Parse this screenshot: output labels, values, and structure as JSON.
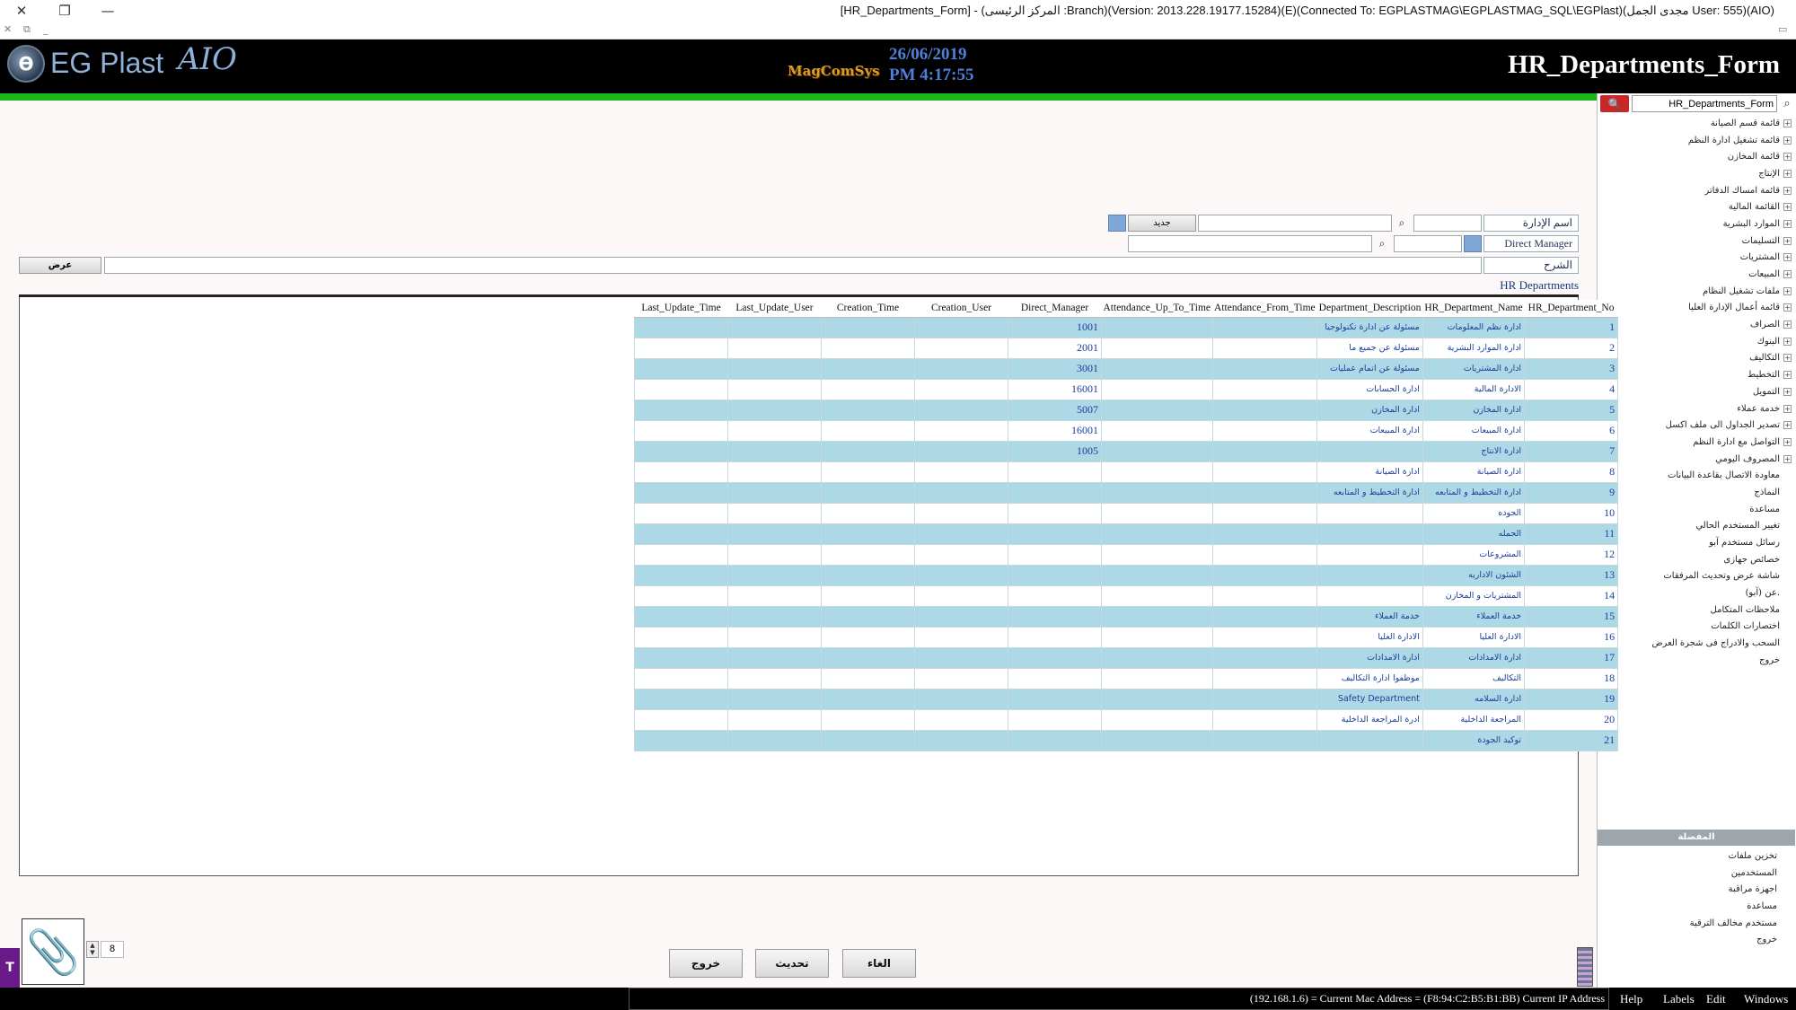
{
  "window": {
    "title": "[HR_Departments_Form] - (المركز الرئيسى :Branch)(Version: 2013.228.19177.15284)(E)(Connected To: EGPLASTMAG\\EGPLASTMAG_SQL\\EGPlast)(مجدى الجمل User: 555)(AIO)",
    "close": "✕",
    "restore": "❐",
    "minimize": "—"
  },
  "mdi": {
    "close": "✕",
    "restore": "⧉",
    "minimize": "_",
    "right_icon": "▭"
  },
  "header": {
    "logo_text": "EG Plast",
    "logo_suffix": "AIO",
    "brand": "MagComSys",
    "date": "26/06/2019",
    "time": "PM 4:17:55",
    "form_title": "HR_Departments_Form"
  },
  "nav": {
    "search_value": "HR_Departments_Form",
    "tree": [
      {
        "label": "قائمة قسم الصيانة",
        "exp": true
      },
      {
        "label": "قائمة تشغيل ادارة النظم",
        "exp": true
      },
      {
        "label": "قائمة المخازن",
        "exp": true
      },
      {
        "label": "الإنتاج",
        "exp": true
      },
      {
        "label": "قائمة امساك الدفاتر",
        "exp": true
      },
      {
        "label": "القائمة المالية",
        "exp": true
      },
      {
        "label": "الموارد البشرية",
        "exp": true
      },
      {
        "label": "التسليمات",
        "exp": true
      },
      {
        "label": "المشتريات",
        "exp": true
      },
      {
        "label": "المبيعات",
        "exp": true
      },
      {
        "label": "ملفات تشغيل النظام",
        "exp": true
      },
      {
        "label": "قائمة أعمال الإدارة العليا",
        "exp": true
      },
      {
        "label": "الصراف",
        "exp": true
      },
      {
        "label": "البنوك",
        "exp": true
      },
      {
        "label": "التكاليف",
        "exp": true
      },
      {
        "label": "التخطيط",
        "exp": true
      },
      {
        "label": "التمويل",
        "exp": true
      },
      {
        "label": "خدمة عملاء",
        "exp": true
      },
      {
        "label": "تصدير الجداول الى ملف اكسل",
        "exp": true
      },
      {
        "label": "التواصل مع ادارة النظم",
        "exp": true
      },
      {
        "label": "المصروف اليومي",
        "exp": true
      },
      {
        "label": "معاودة الاتصال بقاعدة البيانات",
        "exp": false
      },
      {
        "label": "النماذج",
        "exp": false
      },
      {
        "label": "مساعدة",
        "exp": false
      },
      {
        "label": "تغيير المستخدم الحالي",
        "exp": false
      },
      {
        "label": "رسائل مستخدم آبو",
        "exp": false
      },
      {
        "label": "خصائص جهازى",
        "exp": false
      },
      {
        "label": "شاشة عرض وتحديث المرفقات",
        "exp": false
      },
      {
        "label": "عن (آبو).",
        "exp": false
      },
      {
        "label": "ملاحظات المتكامل",
        "exp": false
      },
      {
        "label": "اختصارات الكلمات",
        "exp": false
      },
      {
        "label": "السحب والادراج فى شجرة العرض",
        "exp": false
      },
      {
        "label": "خروج",
        "exp": false
      }
    ],
    "favorites_header": "المفضلة",
    "favorites": [
      "تخزين ملفات",
      "المستخدمين",
      "اجهزة مراقبة",
      "مساعدة",
      "مستخدم مخالف الترقية",
      "خروج"
    ]
  },
  "form": {
    "dept_name_label": "اسم الإدارة",
    "new_button": "جديد",
    "direct_manager_label": "Direct Manager",
    "description_label": "الشرح",
    "view_button": "عرض",
    "section_title": "HR Departments"
  },
  "grid": {
    "columns": [
      "Last_Update_Time",
      "Last_Update_User",
      "Creation_Time",
      "Creation_User",
      "Direct_Manager",
      "Attendance_Up_To_Time",
      "Attendance_From_Time",
      "Department_Description",
      "HR_Department_Name",
      "HR_Department_No"
    ],
    "rows": [
      {
        "no": "1",
        "name": "ادارة نظم المعلومات",
        "desc": "مسئولة عن ادارة تكنولوجيا",
        "mgr": "1001"
      },
      {
        "no": "2",
        "name": "ادارة الموارد البشرية",
        "desc": "مسئولة عن جميع ما",
        "mgr": "2001"
      },
      {
        "no": "3",
        "name": "ادارة المشتريات",
        "desc": "مسئولة عن اتمام عمليات",
        "mgr": "3001"
      },
      {
        "no": "4",
        "name": "الادارة المالية",
        "desc": "ادارة الحسابات",
        "mgr": "16001"
      },
      {
        "no": "5",
        "name": "ادارة المخازن",
        "desc": "ادارة المخازن",
        "mgr": "5007"
      },
      {
        "no": "6",
        "name": "ادارة المبيعات",
        "desc": "ادارة المبيعات",
        "mgr": "16001"
      },
      {
        "no": "7",
        "name": "ادارة الانتاج",
        "desc": "",
        "mgr": "1005"
      },
      {
        "no": "8",
        "name": "ادارة الصيانة",
        "desc": "ادارة الصيانة",
        "mgr": ""
      },
      {
        "no": "9",
        "name": "ادارة التخطيط و المتابعه",
        "desc": "ادارة التخطيط و المتابعه",
        "mgr": ""
      },
      {
        "no": "10",
        "name": "الجوده",
        "desc": "",
        "mgr": ""
      },
      {
        "no": "11",
        "name": "الحمله",
        "desc": "",
        "mgr": ""
      },
      {
        "no": "12",
        "name": "المشروعات",
        "desc": "",
        "mgr": ""
      },
      {
        "no": "13",
        "name": "الشئون الاداريه",
        "desc": "",
        "mgr": ""
      },
      {
        "no": "14",
        "name": "المشتريات و المخازن",
        "desc": "",
        "mgr": ""
      },
      {
        "no": "15",
        "name": "خدمة العملاء",
        "desc": "خدمة العملاء",
        "mgr": ""
      },
      {
        "no": "16",
        "name": "الادارة العليا",
        "desc": "الادارة العليا",
        "mgr": ""
      },
      {
        "no": "17",
        "name": "ادارة الامدادات",
        "desc": "ادارة الامدادات",
        "mgr": ""
      },
      {
        "no": "18",
        "name": "التكاليف",
        "desc": "موظفوا ادارة التكاليف",
        "mgr": ""
      },
      {
        "no": "19",
        "name": "ادارة السلامه",
        "desc": "Safety Department",
        "mgr": ""
      },
      {
        "no": "20",
        "name": "المراجعة الداخلية",
        "desc": "ادرة المراجعة الداخلية",
        "mgr": ""
      },
      {
        "no": "21",
        "name": "توكيد الجودة",
        "desc": "",
        "mgr": ""
      }
    ]
  },
  "bottom": {
    "attach_icon": "paperclip",
    "spinner_value": "8",
    "exit_button": "خروج",
    "refresh_button": "تحديث",
    "cancel_button": "الغاء"
  },
  "status": {
    "ip_text": "(192.168.1.6) = Current Mac Address = (F8:94:C2:B5:B1:BB) Current IP Address",
    "menu_help": "Help",
    "menu_labels": "Labels",
    "menu_edit": "Edit",
    "menu_windows": "Windows"
  },
  "colors": {
    "header_bg": "#000000",
    "green_bar": "#1cb51c",
    "row_alt": "#add8e6",
    "link_blue": "#1a3f9a"
  }
}
